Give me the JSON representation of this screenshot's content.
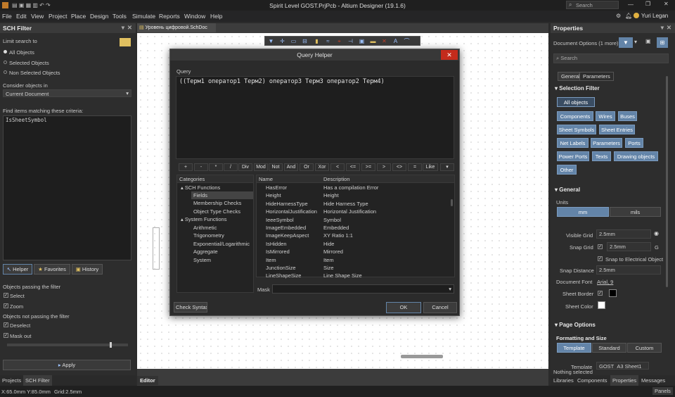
{
  "app": {
    "title": "Spirit Level GOST.PrjPcb - Altium Designer (19.1.6)",
    "search_placeholder": "Search",
    "user": "Yuri Legan"
  },
  "menu": [
    "File",
    "Edit",
    "View",
    "Project",
    "Place",
    "Design",
    "Tools",
    "Simulate",
    "Reports",
    "Window",
    "Help"
  ],
  "left": {
    "title": "SCH Filter",
    "limit_label": "Limit search to",
    "radio": [
      "All Objects",
      "Selected Objects",
      "Non Selected Objects"
    ],
    "consider_label": "Consider objects in",
    "consider_value": "Current Document",
    "find_label": "Find items matching these criteria:",
    "query": "IsSheetSymbol",
    "tabs": [
      "Helper",
      "Favorites",
      "History"
    ],
    "passing_label": "Objects passing the filter",
    "select": "Select",
    "zoom": "Zoom",
    "not_passing_label": "Objects not passing the filter",
    "deselect": "Deselect",
    "mask_out": "Mask out",
    "apply": "Apply",
    "bottom_tabs": [
      "Projects",
      "SCH Filter"
    ]
  },
  "center": {
    "doc_tab": "Уровень цифровой.SchDoc",
    "editor_tab": "Editor"
  },
  "dialog": {
    "title": "Query Helper",
    "query_label": "Query",
    "query_text": "((Терм1 оператор1 Терм2) оператор3 Терм3 оператор2 Терм4)",
    "ops": [
      "+",
      "-",
      "*",
      "/",
      "Div",
      "Mod",
      "Not",
      "And",
      "Or",
      "Xor",
      "<",
      "<=",
      ">=",
      ">",
      "<>",
      "=",
      "Like"
    ],
    "categories_label": "Categories",
    "categories": [
      "SCH Functions",
      "Fields",
      "Membership Checks",
      "Object Type Checks",
      "System Functions",
      "Arithmetic",
      "Trigonometry",
      "Exponential/Logarithmic",
      "Aggregate",
      "System"
    ],
    "col_name": "Name",
    "col_desc": "Description",
    "names": [
      "HasError",
      "Height",
      "HideHarnessType",
      "HorizontalJustification",
      "IeeeSymbol",
      "ImageEmbedded",
      "ImageKeepAspect",
      "IsHidden",
      "IsMirrored",
      "Item",
      "JunctionSize",
      "LineShapeSize"
    ],
    "descs": [
      "Has a compilation Error",
      "Height",
      "Hide Harness Type",
      "Horizontal Justification",
      "Symbol",
      "Embedded",
      "XY Ratio 1:1",
      "Hide",
      "Mirrored",
      "Item",
      "Size",
      "Line Shape Size"
    ],
    "mask_label": "Mask",
    "check": "Check Syntax",
    "ok": "OK",
    "cancel": "Cancel"
  },
  "right": {
    "title": "Properties",
    "doc_options": "Document Options (1 more)",
    "search_placeholder": "Search",
    "tabs": [
      "General",
      "Parameters"
    ],
    "selection_filter": "Selection Filter",
    "all_objects": "All objects",
    "filters": [
      "Components",
      "Wires",
      "Buses",
      "Sheet Symbols",
      "Sheet Entries",
      "Net Labels",
      "Parameters",
      "Ports",
      "Power Ports",
      "Texts",
      "Drawing objects",
      "Other"
    ],
    "general": "General",
    "units_label": "Units",
    "mm": "mm",
    "mils": "mils",
    "visible_grid_label": "Visible Grid",
    "visible_grid": "2.5mm",
    "snap_grid_label": "Snap Grid",
    "snap_grid": "2.5mm",
    "snap_grid_key": "G",
    "snap_electrical": "Snap to Electrical Object",
    "snap_distance_label": "Snap Distance",
    "snap_distance": "2.5mm",
    "doc_font_label": "Document Font",
    "doc_font": "Arial, 9",
    "sheet_border_label": "Sheet Border",
    "sheet_color_label": "Sheet Color",
    "page_options": "Page Options",
    "formatting": "Formatting and Size",
    "fmt_tabs": [
      "Template",
      "Standard",
      "Custom"
    ],
    "template_label": "Template",
    "template_value": "GOST_A3 Sheet1",
    "nothing_selected": "Nothing selected",
    "bottom_tabs": [
      "Libraries",
      "Components",
      "Properties",
      "Messages"
    ]
  },
  "status": {
    "coords": "X:65.0mm Y:85.0mm",
    "grid": "Grid:2.5mm",
    "panels": "Panels"
  },
  "colors": {
    "accent": "#6384a8",
    "close": "#c42b1c"
  }
}
